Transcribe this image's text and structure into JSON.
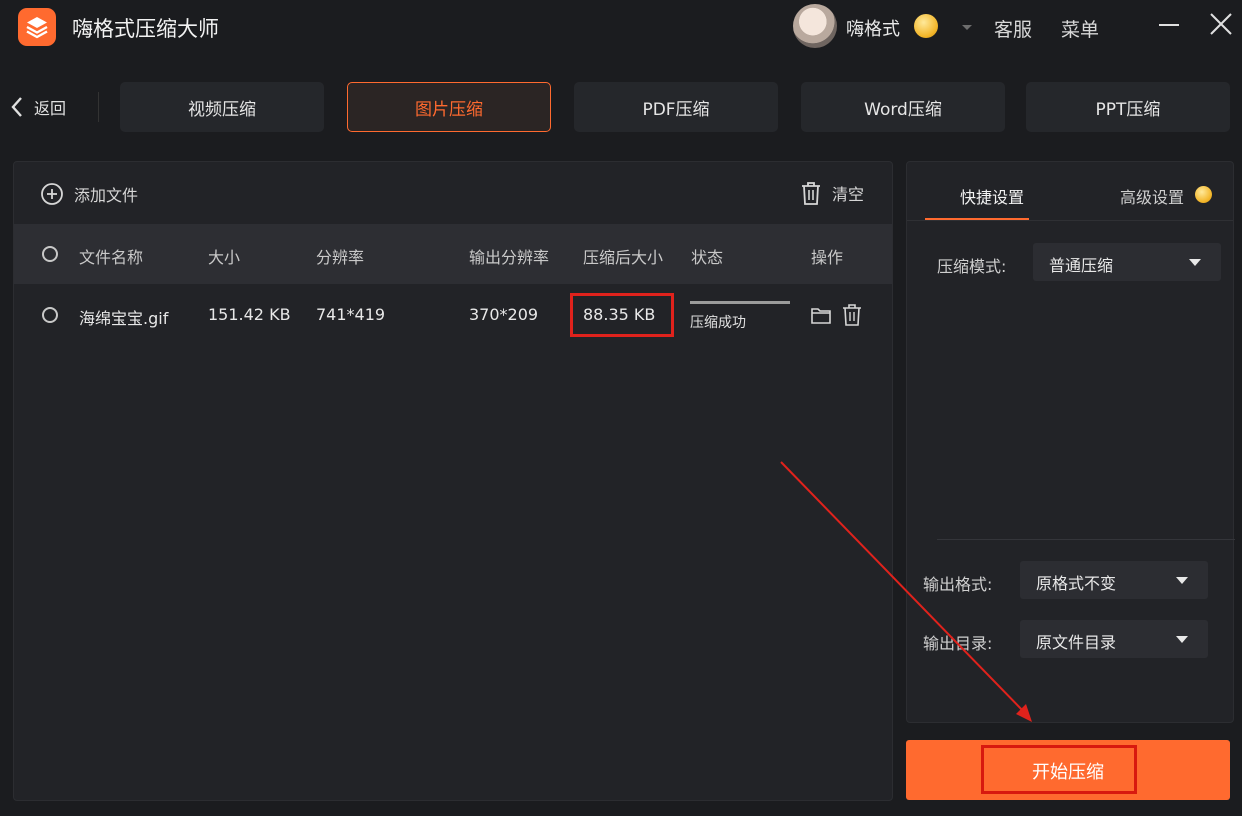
{
  "app": {
    "title": "嗨格式压缩大师",
    "user_name": "嗨格式",
    "service_label": "客服",
    "menu_label": "菜单",
    "accent_color": "#ff6a2f"
  },
  "nav": {
    "back_label": "返回",
    "tabs": [
      {
        "label": "视频压缩",
        "active": false
      },
      {
        "label": "图片压缩",
        "active": true
      },
      {
        "label": "PDF压缩",
        "active": false
      },
      {
        "label": "Word压缩",
        "active": false
      },
      {
        "label": "PPT压缩",
        "active": false
      }
    ]
  },
  "file_list": {
    "add_file_label": "添加文件",
    "clear_label": "清空",
    "columns": [
      "文件名称",
      "大小",
      "分辨率",
      "输出分辨率",
      "压缩后大小",
      "状态",
      "操作"
    ],
    "rows": [
      {
        "name": "海绵宝宝.gif",
        "size": "151.42 KB",
        "resolution": "741*419",
        "output_resolution": "370*209",
        "compressed_size": "88.35 KB",
        "status": "压缩成功",
        "progress": 1.0
      }
    ]
  },
  "settings": {
    "quick_tab": "快捷设置",
    "advanced_tab": "高级设置",
    "compress_mode_label": "压缩模式:",
    "compress_mode_value": "普通压缩",
    "output_format_label": "输出格式:",
    "output_format_value": "原格式不变",
    "output_dir_label": "输出目录:",
    "output_dir_value": "原文件目录"
  },
  "actions": {
    "start_label": "开始压缩"
  },
  "annotation": {
    "highlight_color": "#e0221c"
  }
}
